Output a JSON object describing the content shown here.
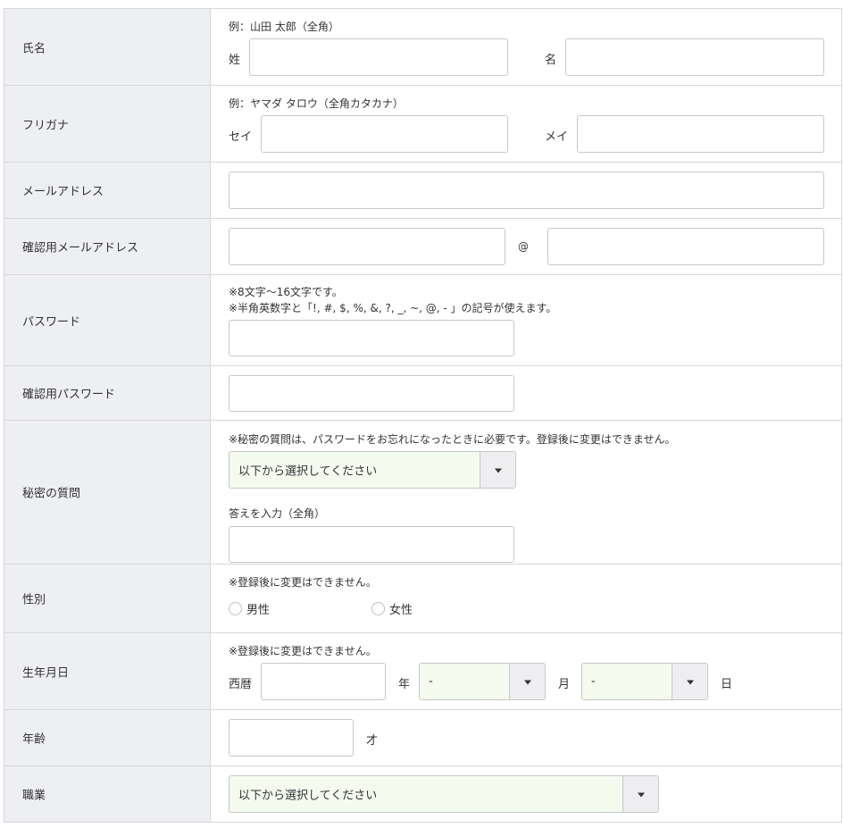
{
  "rows": {
    "name": {
      "label": "氏名",
      "example": "例：山田 太郎（全角）",
      "last_label": "姓",
      "first_label": "名",
      "last_value": "",
      "first_value": ""
    },
    "furigana": {
      "label": "フリガナ",
      "example": "例：ヤマダ タロウ（全角カタカナ）",
      "sei_label": "セイ",
      "mei_label": "メイ",
      "sei_value": "",
      "mei_value": ""
    },
    "email": {
      "label": "メールアドレス",
      "value": ""
    },
    "email_confirm": {
      "label": "確認用メールアドレス",
      "at": "@",
      "local_value": "",
      "domain_value": ""
    },
    "password": {
      "label": "パスワード",
      "note1": "※8文字～16文字です。",
      "note2": "※半角英数字と「!, #, $, %, &, ?, _, ~, @, - 」の記号が使えます。",
      "value": ""
    },
    "password_confirm": {
      "label": "確認用パスワード",
      "value": ""
    },
    "secret": {
      "label": "秘密の質問",
      "note": "※秘密の質問は、パスワードをお忘れになったときに必要です。登録後に変更はできません。",
      "select_value": "以下から選択してください",
      "answer_label": "答えを入力（全角）",
      "answer_value": ""
    },
    "gender": {
      "label": "性別",
      "note": "※登録後に変更はできません。",
      "options": [
        "男性",
        "女性"
      ]
    },
    "birthday": {
      "label": "生年月日",
      "note": "※登録後に変更はできません。",
      "era_label": "西暦",
      "year_label": "年",
      "month_label": "月",
      "day_label": "日",
      "month_value": "-",
      "day_value": "-",
      "year_value": ""
    },
    "age": {
      "label": "年齢",
      "unit": "才",
      "value": ""
    },
    "occupation": {
      "label": "職業",
      "select_value": "以下から選択してください"
    }
  },
  "colors": {
    "label_bg": "#eeeff3",
    "select_bg": "#f4faee",
    "border": "#d8d8d8"
  },
  "icons": {
    "select_caret": "caret-down-icon"
  }
}
